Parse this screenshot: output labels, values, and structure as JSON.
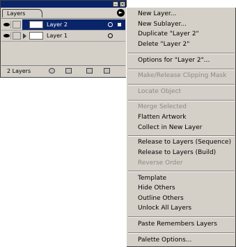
{
  "palette": {
    "tab_label": "Layers",
    "menu_arrow_glyph": "►",
    "minimize_glyph": "–",
    "close_glyph": "×",
    "layers": [
      {
        "name": "Layer 2",
        "selected": true
      },
      {
        "name": "Layer 1",
        "selected": false
      }
    ],
    "footer": {
      "count_label": "2 Layers"
    }
  },
  "menu": {
    "items": [
      {
        "label": "New Layer...",
        "enabled": true
      },
      {
        "label": "New Sublayer...",
        "enabled": true
      },
      {
        "label": "Duplicate \"Layer 2\"",
        "enabled": true
      },
      {
        "label": "Delete \"Layer 2\"",
        "enabled": true
      },
      {
        "label": "Options for \"Layer 2\"...",
        "enabled": true
      },
      {
        "label": "Make/Release Clipping Mask",
        "enabled": false
      },
      {
        "label": "Locate Object",
        "enabled": false
      },
      {
        "label": "Merge Selected",
        "enabled": false
      },
      {
        "label": "Flatten Artwork",
        "enabled": true
      },
      {
        "label": "Collect in New Layer",
        "enabled": true
      },
      {
        "label": "Release to Layers (Sequence)",
        "enabled": true
      },
      {
        "label": "Release to Layers (Build)",
        "enabled": true
      },
      {
        "label": "Reverse Order",
        "enabled": false
      },
      {
        "label": "Template",
        "enabled": true
      },
      {
        "label": "Hide Others",
        "enabled": true
      },
      {
        "label": "Outline Others",
        "enabled": true
      },
      {
        "label": "Unlock All Layers",
        "enabled": true
      },
      {
        "label": "Paste Remembers Layers",
        "enabled": true
      },
      {
        "label": "Palette Options...",
        "enabled": true
      }
    ]
  }
}
